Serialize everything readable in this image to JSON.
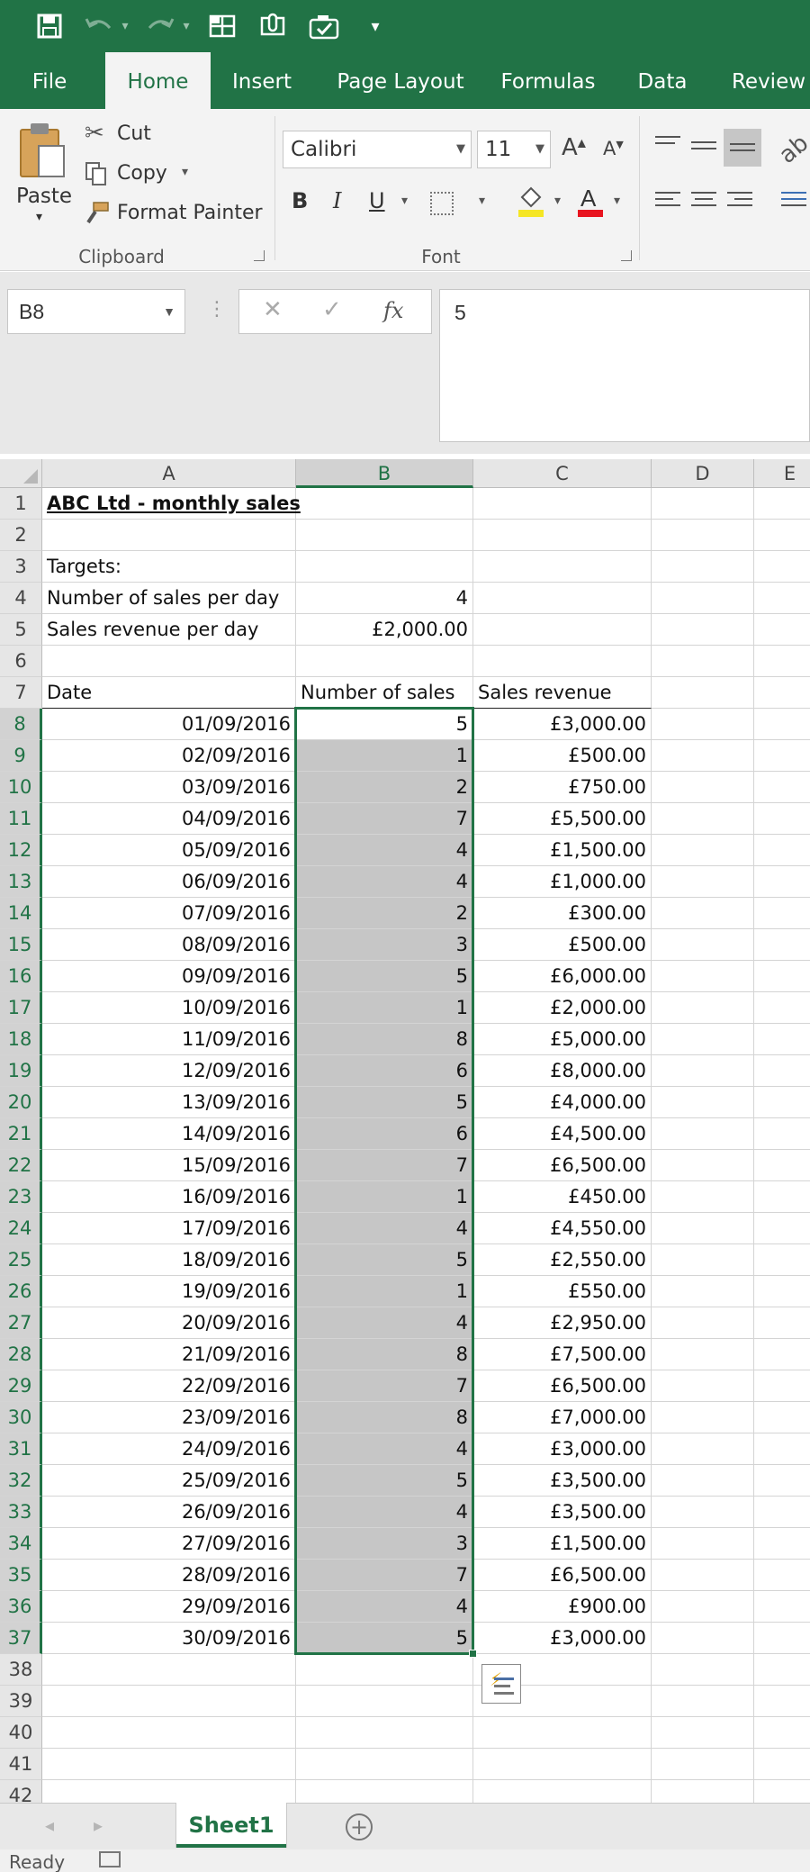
{
  "qat": {
    "icons": [
      "save-icon",
      "undo-icon",
      "redo-icon",
      "table-icon",
      "touch-mode-icon",
      "check-camera-icon",
      "customize-icon"
    ]
  },
  "tabs": [
    "File",
    "Home",
    "Insert",
    "Page Layout",
    "Formulas",
    "Data",
    "Review"
  ],
  "active_tab": "Home",
  "ribbon": {
    "clipboard": {
      "paste": "Paste",
      "cut": "Cut",
      "copy": "Copy",
      "format_painter": "Format Painter",
      "group_label": "Clipboard"
    },
    "font": {
      "name": "Calibri",
      "size": "11",
      "bold": "B",
      "italic": "I",
      "underline": "U",
      "group_label": "Font"
    }
  },
  "formula_bar": {
    "name_box": "B8",
    "value": "5"
  },
  "columns": [
    "A",
    "B",
    "C",
    "D",
    "E"
  ],
  "selected_column": "B",
  "rows_visible": [
    "1",
    "2",
    "3",
    "4",
    "5",
    "6",
    "7",
    "8",
    "9",
    "10",
    "11",
    "12",
    "13",
    "14",
    "15",
    "16",
    "17",
    "18",
    "19",
    "20",
    "21",
    "22",
    "23",
    "24",
    "25",
    "26",
    "27",
    "28",
    "29",
    "30",
    "31",
    "32",
    "33",
    "34",
    "35",
    "36",
    "37",
    "38",
    "39",
    "40",
    "41",
    "42"
  ],
  "sheet": {
    "title": "ABC Ltd - monthly sales",
    "targets_label": "Targets:",
    "target_sales_label": "Number of sales per day",
    "target_sales_value": "4",
    "target_revenue_label": "Sales revenue per day",
    "target_revenue_value": "£2,000.00",
    "headers": [
      "Date",
      "Number of sales",
      "Sales revenue"
    ],
    "rows": [
      [
        "01/09/2016",
        "5",
        "£3,000.00"
      ],
      [
        "02/09/2016",
        "1",
        "£500.00"
      ],
      [
        "03/09/2016",
        "2",
        "£750.00"
      ],
      [
        "04/09/2016",
        "7",
        "£5,500.00"
      ],
      [
        "05/09/2016",
        "4",
        "£1,500.00"
      ],
      [
        "06/09/2016",
        "4",
        "£1,000.00"
      ],
      [
        "07/09/2016",
        "2",
        "£300.00"
      ],
      [
        "08/09/2016",
        "3",
        "£500.00"
      ],
      [
        "09/09/2016",
        "5",
        "£6,000.00"
      ],
      [
        "10/09/2016",
        "1",
        "£2,000.00"
      ],
      [
        "11/09/2016",
        "8",
        "£5,000.00"
      ],
      [
        "12/09/2016",
        "6",
        "£8,000.00"
      ],
      [
        "13/09/2016",
        "5",
        "£4,000.00"
      ],
      [
        "14/09/2016",
        "6",
        "£4,500.00"
      ],
      [
        "15/09/2016",
        "7",
        "£6,500.00"
      ],
      [
        "16/09/2016",
        "1",
        "£450.00"
      ],
      [
        "17/09/2016",
        "4",
        "£4,550.00"
      ],
      [
        "18/09/2016",
        "5",
        "£2,550.00"
      ],
      [
        "19/09/2016",
        "1",
        "£550.00"
      ],
      [
        "20/09/2016",
        "4",
        "£2,950.00"
      ],
      [
        "21/09/2016",
        "8",
        "£7,500.00"
      ],
      [
        "22/09/2016",
        "7",
        "£6,500.00"
      ],
      [
        "23/09/2016",
        "8",
        "£7,000.00"
      ],
      [
        "24/09/2016",
        "4",
        "£3,000.00"
      ],
      [
        "25/09/2016",
        "5",
        "£3,500.00"
      ],
      [
        "26/09/2016",
        "4",
        "£3,500.00"
      ],
      [
        "27/09/2016",
        "3",
        "£1,500.00"
      ],
      [
        "28/09/2016",
        "7",
        "£6,500.00"
      ],
      [
        "29/09/2016",
        "4",
        "£900.00"
      ],
      [
        "30/09/2016",
        "5",
        "£3,000.00"
      ]
    ]
  },
  "sheet_tabs": [
    "Sheet1"
  ],
  "status": "Ready",
  "colors": {
    "accent": "#217346",
    "highlight": "#c6c6c6"
  }
}
